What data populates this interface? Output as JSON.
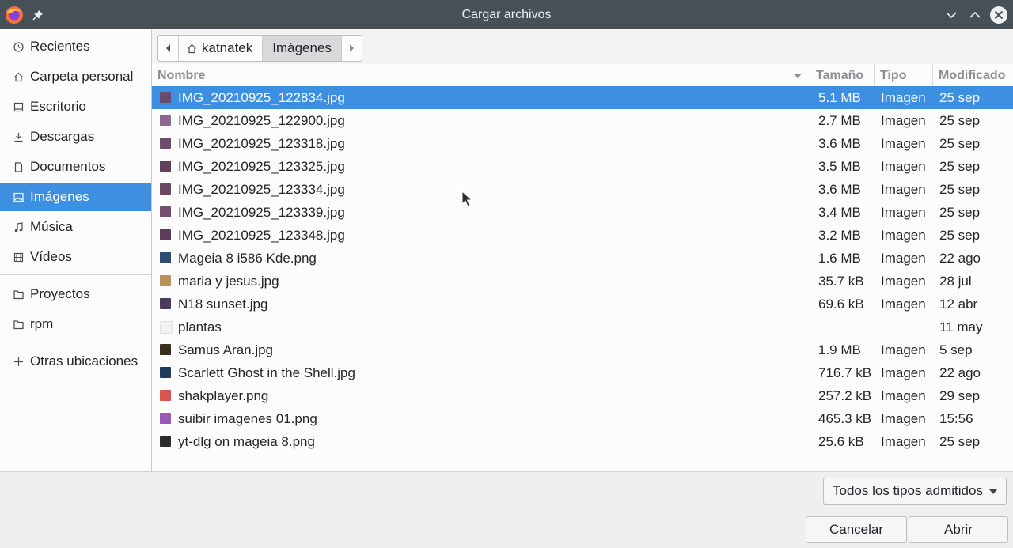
{
  "window": {
    "title": "Cargar archivos",
    "app_icon": "firefox-icon",
    "pin_icon": "pin-icon",
    "controls": [
      "minimize-icon",
      "maximize-icon",
      "close-icon"
    ]
  },
  "sidebar": {
    "items": [
      {
        "label": "Recientes",
        "icon": "clock-icon"
      },
      {
        "label": "Carpeta personal",
        "icon": "home-icon"
      },
      {
        "label": "Escritorio",
        "icon": "desktop-icon"
      },
      {
        "label": "Descargas",
        "icon": "download-icon"
      },
      {
        "label": "Documentos",
        "icon": "document-icon"
      },
      {
        "label": "Imágenes",
        "icon": "image-icon",
        "active": true
      },
      {
        "label": "Música",
        "icon": "music-icon"
      },
      {
        "label": "Vídeos",
        "icon": "video-icon"
      },
      {
        "label": "Proyectos",
        "icon": "folder-icon"
      },
      {
        "label": "rpm",
        "icon": "folder-icon"
      },
      {
        "label": "Otras ubicaciones",
        "icon": "plus-icon"
      }
    ]
  },
  "pathbar": {
    "home": "katnatek",
    "current": "Imágenes"
  },
  "columns": {
    "name": "Nombre",
    "size": "Tamaño",
    "type": "Tipo",
    "modified": "Modificado"
  },
  "files": [
    {
      "name": "IMG_20210925_122834.jpg",
      "size": "5.1 MB",
      "type": "Imagen",
      "modified": "25 sep",
      "selected": true,
      "thumb": "#6b4a6e"
    },
    {
      "name": "IMG_20210925_122900.jpg",
      "size": "2.7 MB",
      "type": "Imagen",
      "modified": "25 sep",
      "thumb": "#8d6a8f"
    },
    {
      "name": "IMG_20210925_123318.jpg",
      "size": "3.6 MB",
      "type": "Imagen",
      "modified": "25 sep",
      "thumb": "#6e4c6a"
    },
    {
      "name": "IMG_20210925_123325.jpg",
      "size": "3.5 MB",
      "type": "Imagen",
      "modified": "25 sep",
      "thumb": "#5f3f5c"
    },
    {
      "name": "IMG_20210925_123334.jpg",
      "size": "3.6 MB",
      "type": "Imagen",
      "modified": "25 sep",
      "thumb": "#6a4866"
    },
    {
      "name": "IMG_20210925_123339.jpg",
      "size": "3.4 MB",
      "type": "Imagen",
      "modified": "25 sep",
      "thumb": "#735071"
    },
    {
      "name": "IMG_20210925_123348.jpg",
      "size": "3.2 MB",
      "type": "Imagen",
      "modified": "25 sep",
      "thumb": "#5c3c59"
    },
    {
      "name": "Mageia 8 i586 Kde.png",
      "size": "1.6 MB",
      "type": "Imagen",
      "modified": "22 ago",
      "thumb": "#2c4d73"
    },
    {
      "name": "maria y jesus.jpg",
      "size": "35.7 kB",
      "type": "Imagen",
      "modified": "28 jul",
      "thumb": "#b9925a"
    },
    {
      "name": "N18 sunset.jpg",
      "size": "69.6 kB",
      "type": "Imagen",
      "modified": "12 abr",
      "thumb": "#4b3a5e"
    },
    {
      "name": "plantas",
      "size": "",
      "type": "",
      "modified": "11 may",
      "thumb": "#f2f2f2"
    },
    {
      "name": "Samus Aran.jpg",
      "size": "1.9 MB",
      "type": "Imagen",
      "modified": "5 sep",
      "thumb": "#3a2f1c"
    },
    {
      "name": "Scarlett Ghost in the Shell.jpg",
      "size": "716.7 kB",
      "type": "Imagen",
      "modified": "22 ago",
      "thumb": "#1f3a5a"
    },
    {
      "name": "shakplayer.png",
      "size": "257.2 kB",
      "type": "Imagen",
      "modified": "29 sep",
      "thumb": "#d9534f"
    },
    {
      "name": "suibir imagenes 01.png",
      "size": "465.3 kB",
      "type": "Imagen",
      "modified": "15:56",
      "thumb": "#9b59b6"
    },
    {
      "name": "yt-dlg on mageia 8.png",
      "size": "25.6 kB",
      "type": "Imagen",
      "modified": "25 sep",
      "thumb": "#2b2b2b"
    }
  ],
  "filter": {
    "label": "Todos los tipos admitidos"
  },
  "buttons": {
    "cancel": "Cancelar",
    "open": "Abrir"
  },
  "colors": {
    "accent": "#3d8fe1",
    "titlebar": "#475057"
  }
}
